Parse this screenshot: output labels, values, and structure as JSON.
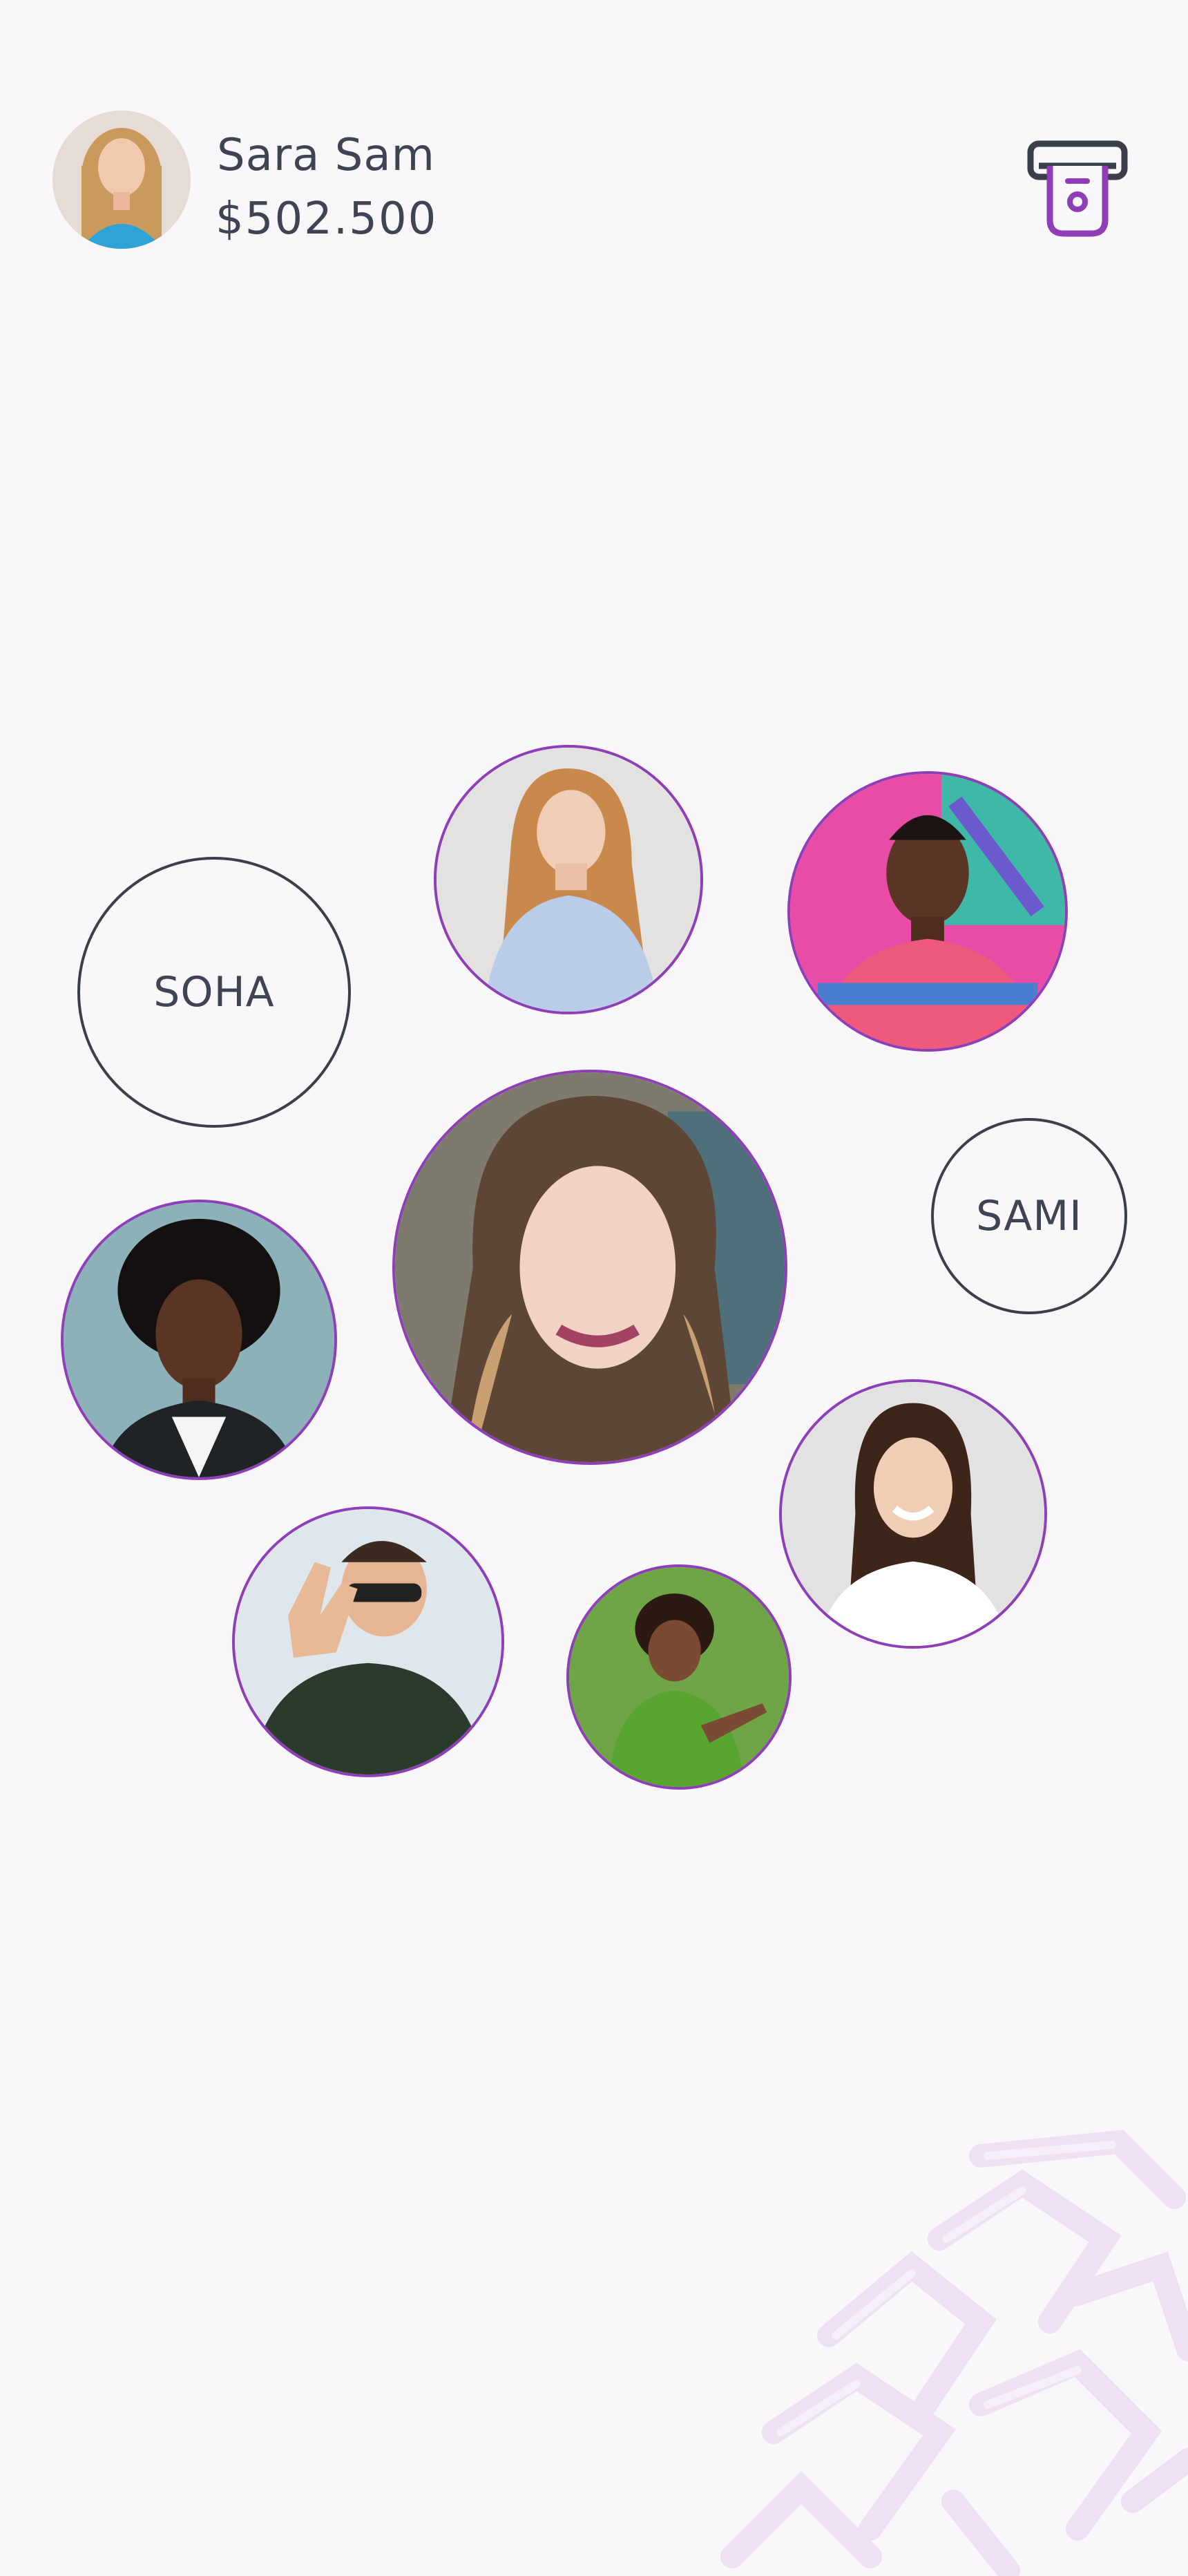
{
  "user": {
    "name": "Sara Sam",
    "balance": "$502.500",
    "avatar_icon": "user-avatar-photo"
  },
  "header": {
    "atm_icon": "atm-withdraw-icon",
    "accent_color": "#8e3fb7"
  },
  "contacts": {
    "text_bubbles": [
      {
        "label": "SOHA"
      },
      {
        "label": "SAMI"
      }
    ],
    "photo_bubbles": [
      {
        "icon": "contact-photo-woman-glasses"
      },
      {
        "icon": "contact-photo-man-pink-shirt"
      },
      {
        "icon": "contact-photo-woman-featured"
      },
      {
        "icon": "contact-photo-woman-afro"
      },
      {
        "icon": "contact-photo-woman-smiling"
      },
      {
        "icon": "contact-photo-man-peace-sign"
      },
      {
        "icon": "contact-photo-woman-green-shirt"
      }
    ]
  },
  "colors": {
    "background": "#faf7fb",
    "text": "#3e4453",
    "bubble_border": "#8e3fb7",
    "decor": "#ecdff3"
  }
}
